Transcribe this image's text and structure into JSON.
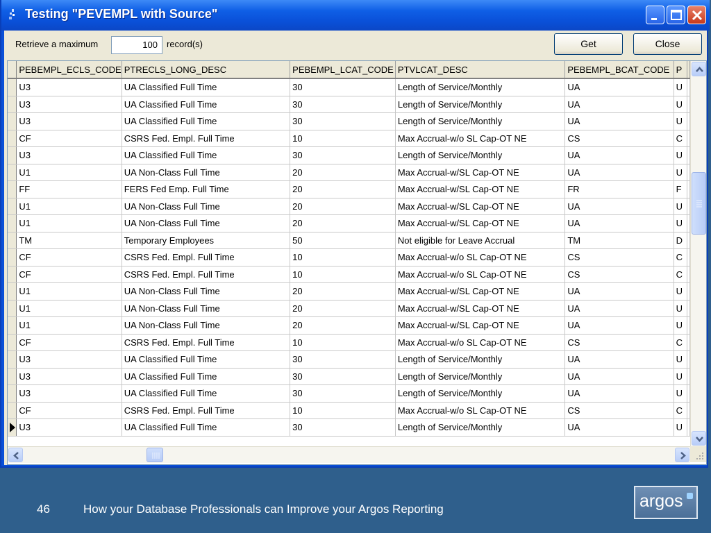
{
  "window": {
    "title": "Testing \"PEVEMPL with Source\""
  },
  "toolbar": {
    "retrieve_label": "Retrieve a maximum",
    "max_records": "100",
    "records_suffix": "record(s)",
    "get_label": "Get",
    "close_label": "Close"
  },
  "grid": {
    "columns": [
      "PEBEMPL_ECLS_CODE",
      "PTRECLS_LONG_DESC",
      "PEBEMPL_LCAT_CODE",
      "PTVLCAT_DESC",
      "PEBEMPL_BCAT_CODE",
      "P"
    ],
    "rows": [
      [
        "U3",
        "UA Classified Full Time",
        "30",
        "Length of Service/Monthly",
        "UA",
        "U"
      ],
      [
        "U3",
        "UA Classified Full Time",
        "30",
        "Length of Service/Monthly",
        "UA",
        "U"
      ],
      [
        "U3",
        "UA Classified Full Time",
        "30",
        "Length of Service/Monthly",
        "UA",
        "U"
      ],
      [
        "CF",
        "CSRS Fed. Empl. Full Time",
        "10",
        "Max Accrual-w/o SL Cap-OT NE",
        "CS",
        "C"
      ],
      [
        "U3",
        "UA Classified Full Time",
        "30",
        "Length of Service/Monthly",
        "UA",
        "U"
      ],
      [
        "U1",
        "UA Non-Class Full Time",
        "20",
        "Max Accrual-w/SL Cap-OT NE",
        "UA",
        "U"
      ],
      [
        "FF",
        "FERS Fed Emp. Full Time",
        "20",
        "Max Accrual-w/SL Cap-OT NE",
        "FR",
        "F"
      ],
      [
        "U1",
        "UA Non-Class Full Time",
        "20",
        "Max Accrual-w/SL Cap-OT NE",
        "UA",
        "U"
      ],
      [
        "U1",
        "UA Non-Class Full Time",
        "20",
        "Max Accrual-w/SL Cap-OT NE",
        "UA",
        "U"
      ],
      [
        "TM",
        "Temporary Employees",
        "50",
        "Not eligible for Leave Accrual",
        "TM",
        "D"
      ],
      [
        "CF",
        "CSRS Fed. Empl. Full Time",
        "10",
        "Max Accrual-w/o SL Cap-OT NE",
        "CS",
        "C"
      ],
      [
        "CF",
        "CSRS Fed. Empl. Full Time",
        "10",
        "Max Accrual-w/o SL Cap-OT NE",
        "CS",
        "C"
      ],
      [
        "U1",
        "UA Non-Class Full Time",
        "20",
        "Max Accrual-w/SL Cap-OT NE",
        "UA",
        "U"
      ],
      [
        "U1",
        "UA Non-Class Full Time",
        "20",
        "Max Accrual-w/SL Cap-OT NE",
        "UA",
        "U"
      ],
      [
        "U1",
        "UA Non-Class Full Time",
        "20",
        "Max Accrual-w/SL Cap-OT NE",
        "UA",
        "U"
      ],
      [
        "CF",
        "CSRS Fed. Empl. Full Time",
        "10",
        "Max Accrual-w/o SL Cap-OT NE",
        "CS",
        "C"
      ],
      [
        "U3",
        "UA Classified Full Time",
        "30",
        "Length of Service/Monthly",
        "UA",
        "U"
      ],
      [
        "U3",
        "UA Classified Full Time",
        "30",
        "Length of Service/Monthly",
        "UA",
        "U"
      ],
      [
        "U3",
        "UA Classified Full Time",
        "30",
        "Length of Service/Monthly",
        "UA",
        "U"
      ],
      [
        "CF",
        "CSRS Fed. Empl. Full Time",
        "10",
        "Max Accrual-w/o SL Cap-OT NE",
        "CS",
        "C"
      ],
      [
        "U3",
        "UA Classified Full Time",
        "30",
        "Length of Service/Monthly",
        "UA",
        "U"
      ]
    ],
    "current_row_index": 20
  },
  "footer": {
    "slide_number": "46",
    "caption": "How your Database Professionals can Improve your Argos Reporting",
    "logo_text": "argos"
  },
  "colors": {
    "titlebar": "#0a50d8",
    "slide_background": "#2f5f8c",
    "dialog_face": "#ece9d8"
  }
}
